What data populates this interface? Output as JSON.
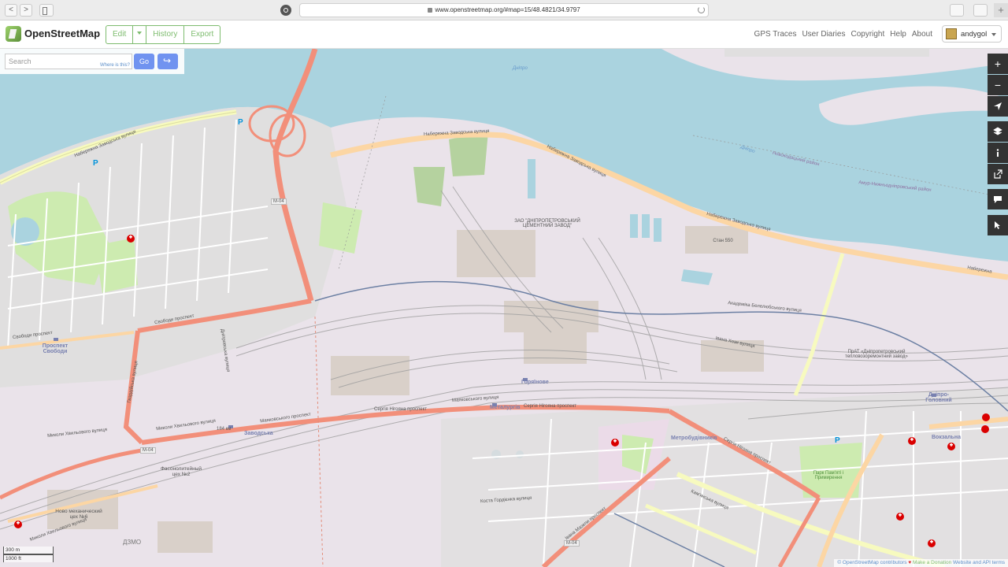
{
  "browser": {
    "url": "www.openstreetmap.org/#map=15/48.4821/34.9797",
    "nav_back": "<",
    "nav_forward": ">",
    "new_tab": "+"
  },
  "header": {
    "logo_text": "OpenStreetMap",
    "edit_label": "Edit",
    "history_label": "History",
    "export_label": "Export",
    "links": [
      "GPS Traces",
      "User Diaries",
      "Copyright",
      "Help",
      "About"
    ],
    "username": "andygol"
  },
  "search": {
    "placeholder": "Search",
    "where_label": "Where is this?",
    "go_label": "Go"
  },
  "controls": {
    "zoom_in": "+",
    "zoom_out": "−"
  },
  "map": {
    "labels": {
      "river": "Дніпро",
      "embankment_1": "Набережна Заводська вулиця",
      "embankment_2": "Набережна Заводська вулиця",
      "embankment_3": "Набережна Заводська вулиця",
      "embankment_4": "Набережна",
      "embankment_5": "Набережна Заводська вулиця",
      "district": "Новокодацький район",
      "district_2": "Амур-Нижньодніпровський район",
      "river_2": "Дніпро",
      "cement_plant": "ЗАО \"ДНІПРОПЕТРОВСЬКИЙ ЦЕМЕНТНИЙ ЗАВОД\"",
      "mill": "Стан 550",
      "teplo": "ПрАТ «Дніпропетровський тепловозоремонтний завод»",
      "avenue_svobody": "Свободи проспект",
      "avenue_svobody_2": "Свободи проспект",
      "avenue_ngyana": "Сергія Нігояна проспект",
      "avenue_ngyana_2": "Сергія Нігояна проспект",
      "avenue_ngyana_3": "Сергія Нігояна проспект",
      "mayakovskoho": "Маяковського проспект",
      "khvylovoho": "Миколи Хвильового вулиця",
      "khvylovoho_2": "Миколи Хвильового вулиця",
      "khvylovoho_3": "Миколи Хвильового вулиця",
      "zavodska_station": "Заводська",
      "gorianove": "Горяїнове",
      "metalurhiv": "Металургів",
      "metrobudivnykiv": "Метробудівників",
      "vokzalna": "Вокзальна",
      "dnipro_holovnyi": "Дніпро-Головний",
      "prospekt_svobody": "Проспект Свободи",
      "park": "Парк Пам'яті і Примирення",
      "fasonno": "Фасонолитейный цех №2",
      "novo_mech": "Ново механический цех №6",
      "dzmo": "ДЗМО",
      "km184": "184 км",
      "m04_a": "M-04",
      "m04_b": "M-04",
      "m04_c": "M-04",
      "bielelivskoho": "Академіка Белелюбського вулиця",
      "yakova_hozy": "Івана Хози вулиця",
      "hvardiiska": "Гвардійська вулиця",
      "kamianska": "Кам'янська вулиця",
      "kosta": "Коста Гордієнка вулиця",
      "metalurhiv_st": "Маяковського вулиця",
      "dniprovska": "Дніпровська вулиця",
      "ivana_mazepy": "Івана Мазепи проспект"
    }
  },
  "scale": {
    "metric": "300 m",
    "imperial": "1000 ft"
  },
  "attribution": {
    "copyright": "© OpenStreetMap contributors",
    "heart": "♥",
    "donation": "Make a Donation",
    "terms": "Website and API terms"
  },
  "colors": {
    "water": "#aad3df",
    "industrial": "#ebdbe8",
    "residential": "#e0dfdf",
    "park": "#cdebb0",
    "primary_road": "#f28f7a",
    "secondary_road": "#fcd6a4",
    "tertiary_road": "#f7fabf",
    "accent": "#7ebc6f"
  }
}
